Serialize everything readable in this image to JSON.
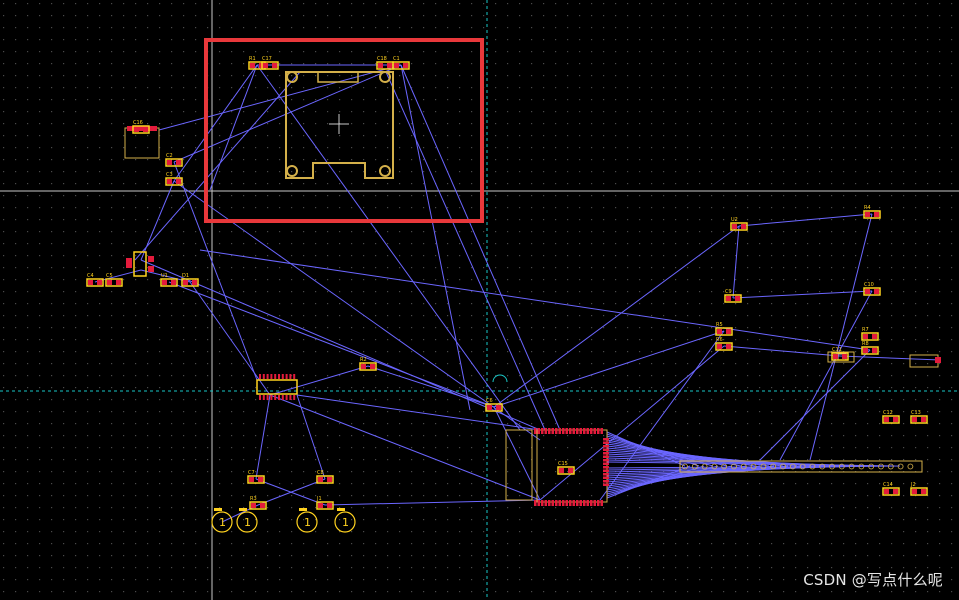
{
  "watermark": "CSDN @写点什么呢",
  "colors": {
    "background": "#000000",
    "grid_dot": "#4a4a4a",
    "ratsnest": "#6b66ff",
    "silkscreen": "#d4b04a",
    "pad": "#e41b3c",
    "pad_outline": "#ffd21f",
    "crosshair": "#c8c8c8",
    "guide": "#19c6c6",
    "selection": "#e8383b"
  },
  "designators": [
    "R1",
    "C1",
    "C2",
    "C3",
    "C4",
    "C5",
    "U1",
    "D1",
    "R2",
    "C6",
    "C7",
    "R3",
    "C8",
    "J1",
    "U2",
    "R4",
    "C9",
    "C10",
    "R5",
    "R6",
    "R7",
    "R8",
    "C11",
    "C12",
    "C13",
    "C14",
    "J2",
    "C15",
    "C16",
    "C17",
    "C18"
  ],
  "test_points": [
    "1",
    "1",
    "1",
    "1"
  ]
}
